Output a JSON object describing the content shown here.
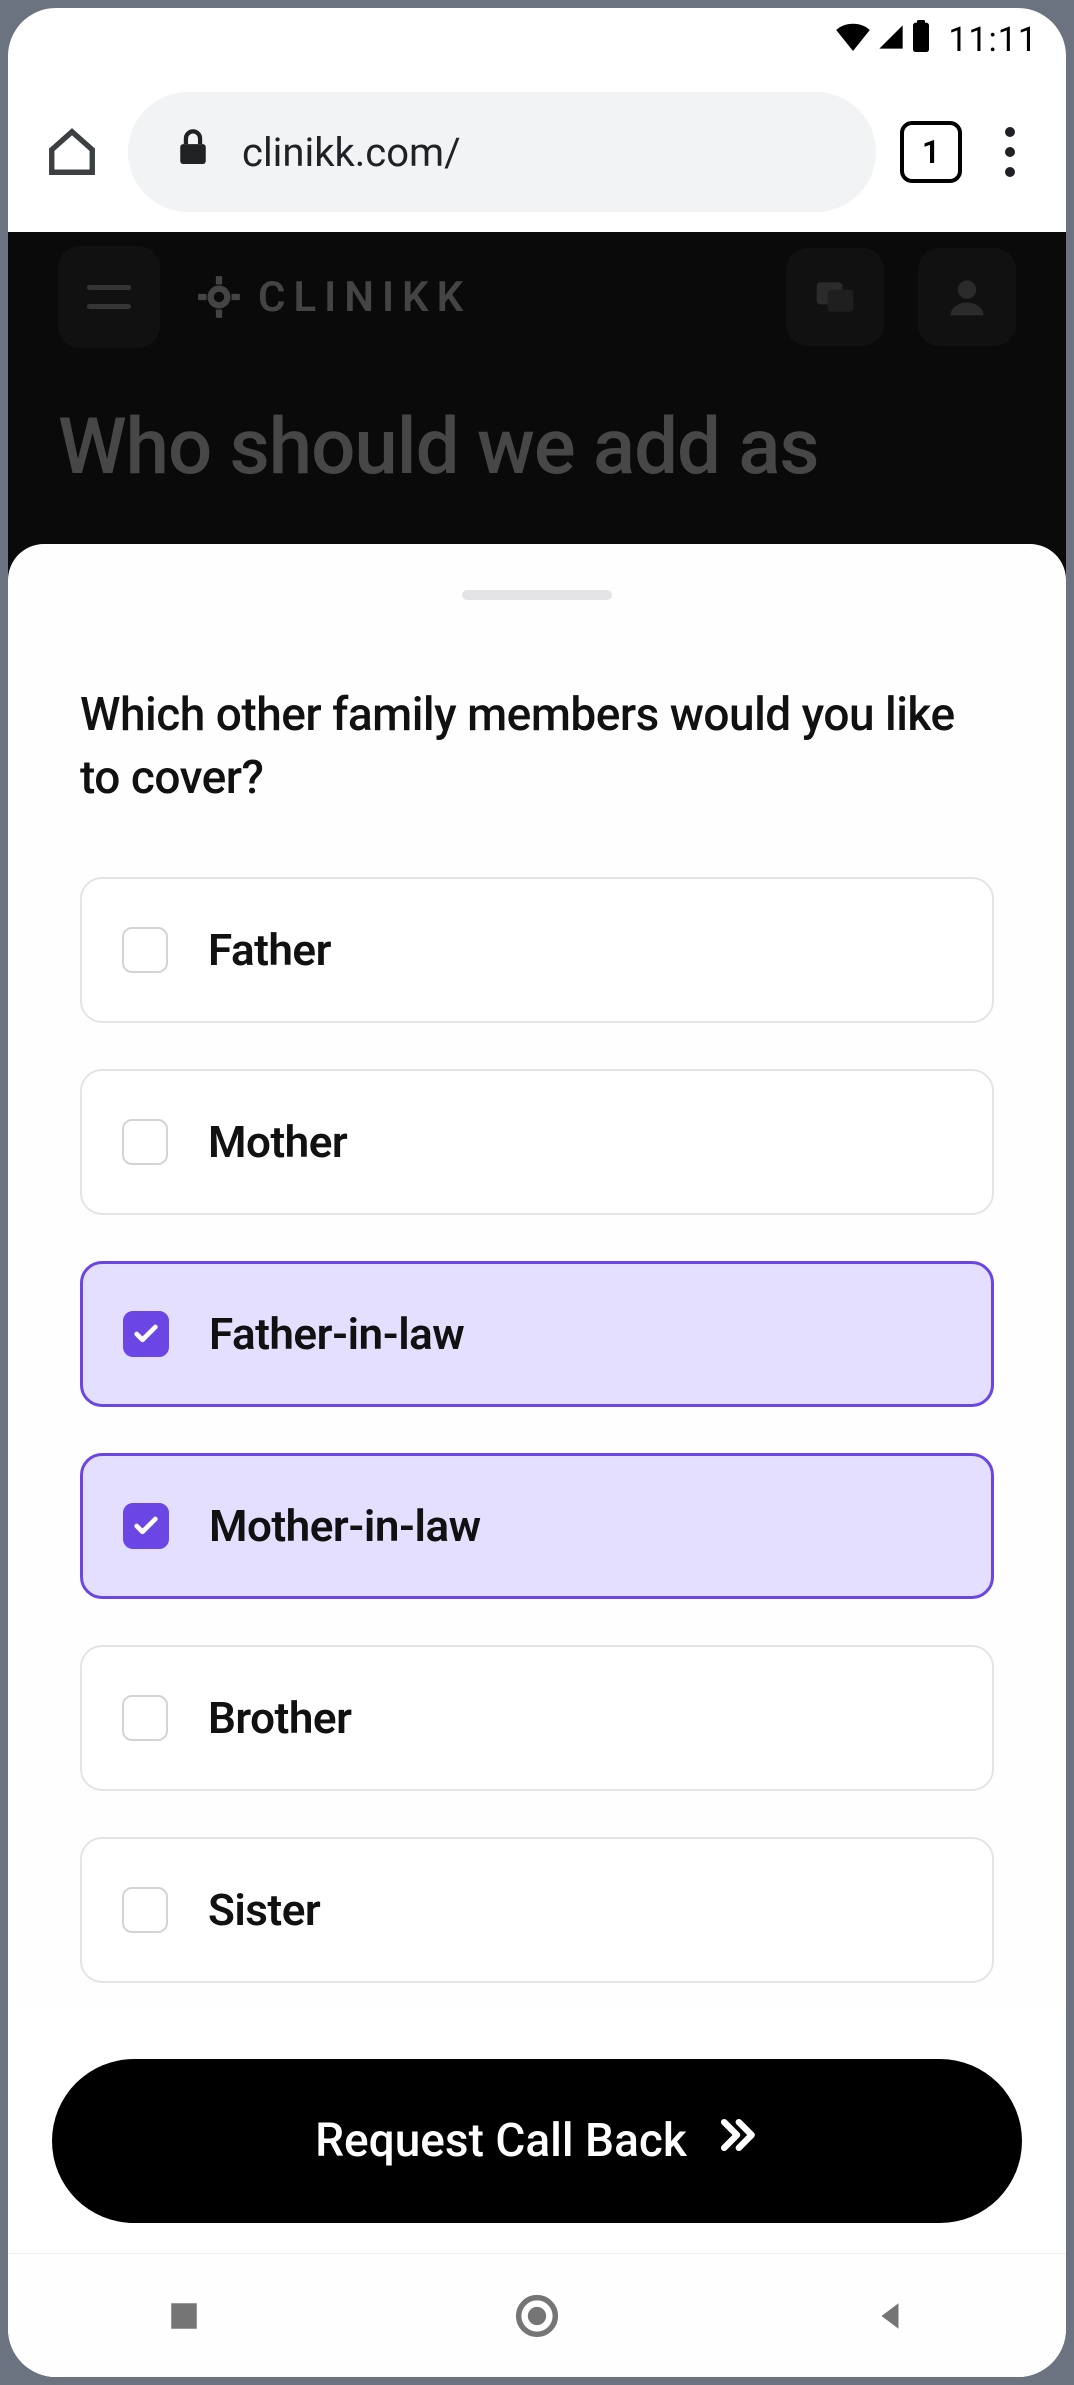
{
  "status": {
    "time": "11:11"
  },
  "browser": {
    "url": "clinikk.com/",
    "tab_count": "1"
  },
  "app_header": {
    "brand": "CLINIKK"
  },
  "background_heading": "Who should we add as",
  "sheet": {
    "question": "Which other family members would you like to cover?",
    "options": [
      {
        "label": "Father",
        "selected": false
      },
      {
        "label": "Mother",
        "selected": false
      },
      {
        "label": "Father-in-law",
        "selected": true
      },
      {
        "label": "Mother-in-law",
        "selected": true
      },
      {
        "label": "Brother",
        "selected": false
      },
      {
        "label": "Sister",
        "selected": false
      }
    ],
    "cta_label": "Request Call Back"
  }
}
